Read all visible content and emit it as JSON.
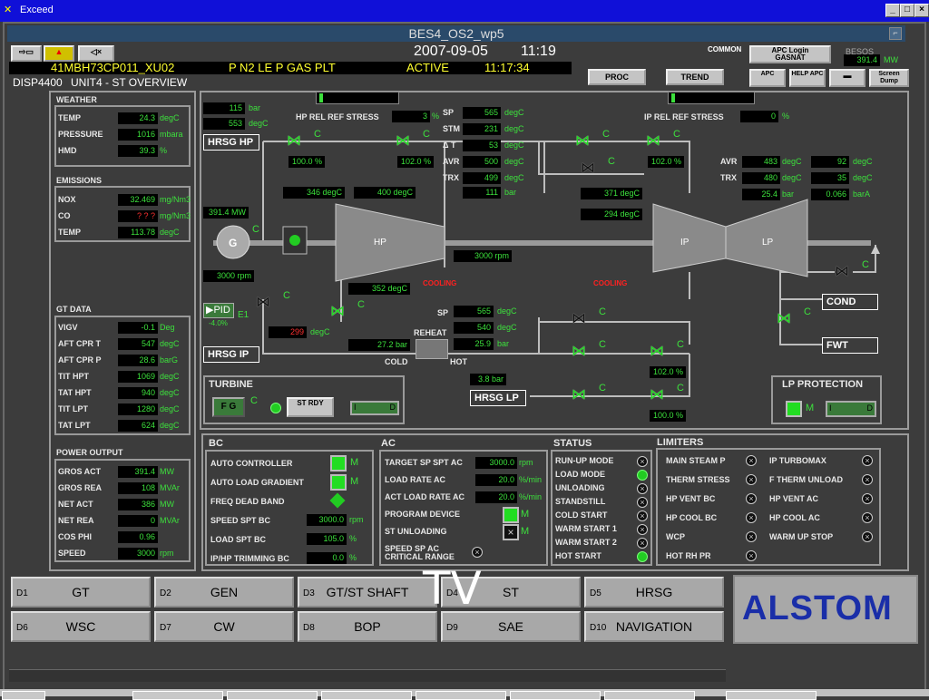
{
  "window": {
    "title": "Exceed",
    "controls": [
      "_",
      "□",
      "×"
    ]
  },
  "header": {
    "station": "BES4_OS2_wp5",
    "date": "2007-09-05",
    "time": "11:19",
    "tag": "41MBH73CP011_XU02",
    "desc": "P N2 LE P GAS PLT",
    "state": "ACTIVE",
    "clock": "11:17:34",
    "display": "DISP4400",
    "unit": "UNIT4 - ST OVERVIEW",
    "common": "COMMON",
    "apc_login": "APC Login",
    "apc_user": "GASNAT",
    "besos": "BESOS",
    "besos_val": "391.4",
    "besos_unit": "MW",
    "proc": "PROC",
    "trend": "TREND",
    "apc": "APC",
    "help_apc": "HELP APC",
    "screen_dump": "Screen Dump"
  },
  "weather": {
    "title": "WEATHER",
    "rows": [
      {
        "l": "TEMP",
        "v": "24.3",
        "u": "degC"
      },
      {
        "l": "PRESSURE",
        "v": "1016",
        "u": "mbara"
      },
      {
        "l": "HMD",
        "v": "39.3",
        "u": "%"
      }
    ]
  },
  "emissions": {
    "title": "EMISSIONS",
    "rows": [
      {
        "l": "NOX",
        "v": "32.469",
        "u": "mg/Nm3"
      },
      {
        "l": "CO",
        "v": "? ? ?",
        "u": "mg/Nm3"
      },
      {
        "l": "TEMP",
        "v": "113.78",
        "u": "degC"
      }
    ]
  },
  "gtdata": {
    "title": "GT DATA",
    "rows": [
      {
        "l": "VIGV",
        "v": "-0.1",
        "u": "Deg"
      },
      {
        "l": "AFT CPR T",
        "v": "547",
        "u": "degC"
      },
      {
        "l": "AFT CPR P",
        "v": "28.6",
        "u": "barG"
      },
      {
        "l": "TIT HPT",
        "v": "1069",
        "u": "degC"
      },
      {
        "l": "TAT HPT",
        "v": "940",
        "u": "degC"
      },
      {
        "l": "TIT LPT",
        "v": "1280",
        "u": "degC"
      },
      {
        "l": "TAT LPT",
        "v": "624",
        "u": "degC"
      }
    ]
  },
  "power": {
    "title": "POWER OUTPUT",
    "rows": [
      {
        "l": "GROS ACT",
        "v": "391.4",
        "u": "MW"
      },
      {
        "l": "GROS REA",
        "v": "108",
        "u": "MVAr"
      },
      {
        "l": "NET ACT",
        "v": "386",
        "u": "MW"
      },
      {
        "l": "NET REA",
        "v": "0",
        "u": "MVAr"
      },
      {
        "l": "COS PHI",
        "v": "0.96",
        "u": ""
      },
      {
        "l": "SPEED",
        "v": "3000",
        "u": "rpm"
      }
    ]
  },
  "diagram": {
    "hp_bar": "115",
    "hp_bar_u": "bar",
    "hp_degc": "553",
    "hp_degc_u": "degC",
    "hrsg_hp": "HRSG HP",
    "hrsg_ip": "HRSG IP",
    "hrsg_lp": "HRSG LP",
    "hp_stress": "HP REL REF STRESS",
    "hp_stress_v": "3",
    "ip_stress": "IP REL REF STRESS",
    "ip_stress_v": "0",
    "pct": "%",
    "sp": "SP",
    "stm": "STM",
    "dt": "Δ T",
    "avr": "AVR",
    "trx": "TRX",
    "sp_v": "565",
    "stm_v": "231",
    "dt_v": "53",
    "avr_v": "500",
    "trx_v": "499",
    "bar_v": "111",
    "degc": "degC",
    "bar": "bar",
    "barA": "barA",
    "v1": "100.0",
    "v2": "102.0",
    "v3": "102.0",
    "v4": "102.0",
    "v5": "100.0",
    "hp_in1": "346",
    "hp_in2": "400",
    "ip_t1": "371",
    "ip_t2": "294",
    "ip_avr": "483",
    "ip_trx": "480",
    "ip_bar": "25.4",
    "lp_t1": "92",
    "lp_t2": "35",
    "lp_p": "0.066",
    "mw": "391.4",
    "mw_u": "MW",
    "rpm1": "3000",
    "rpm2": "3000",
    "rpm_u": "rpm",
    "g": "G",
    "hp": "HP",
    "ip": "IP",
    "lp": "LP",
    "cooling": "COOLING",
    "hp_out": "352",
    "red_t": "299",
    "pid": "PID",
    "e1": "E1",
    "pid_v": "-4.0%",
    "c": "C",
    "rh_sp": "565",
    "rh_t": "540",
    "rh_p": "25.9",
    "cold_p": "27.2",
    "reheat": "REHEAT",
    "cold": "COLD",
    "hot": "HOT",
    "lp_in": "3.8",
    "cond": "COND",
    "fwt": "FWT"
  },
  "turbine": {
    "title": "TURBINE",
    "fg": "F G",
    "c": "C",
    "st_rdy": "ST RDY",
    "i": "I",
    "d": "D"
  },
  "lpprot": {
    "title": "LP PROTECTION",
    "m": "M",
    "i": "I",
    "d": "D"
  },
  "bc": {
    "title": "BC",
    "rows": [
      {
        "l": "AUTO CONTROLLER",
        "s": "M"
      },
      {
        "l": "AUTO LOAD GRADIENT",
        "s": "M"
      },
      {
        "l": "FREQ DEAD BAND",
        "s": ""
      },
      {
        "l": "SPEED SPT BC",
        "v": "3000.0",
        "u": "rpm"
      },
      {
        "l": "LOAD SPT BC",
        "v": "105.0",
        "u": "%"
      },
      {
        "l": "IP/HP TRIMMING BC",
        "v": "0.0",
        "u": "%"
      }
    ]
  },
  "ac": {
    "title": "AC",
    "rows": [
      {
        "l": "TARGET SP SPT AC",
        "v": "3000.0",
        "u": "rpm"
      },
      {
        "l": "LOAD RATE AC",
        "v": "20.0",
        "u": "%/min"
      },
      {
        "l": "ACT LOAD RATE AC",
        "v": "20.0",
        "u": "%/min"
      },
      {
        "l": "PROGRAM DEVICE",
        "s": "M"
      },
      {
        "l": "ST UNLOADING",
        "s": "M"
      },
      {
        "l": "SPEED SP AC CRITICAL RANGE",
        "s": ""
      }
    ]
  },
  "status": {
    "title": "STATUS",
    "rows": [
      "RUN-UP MODE",
      "LOAD MODE",
      "UNLOADING",
      "STANDSTILL",
      "COLD START",
      "WARM START 1",
      "WARM START 2",
      "HOT START"
    ]
  },
  "limiters": {
    "title": "LIMITERS",
    "left": [
      "MAIN STEAM P",
      "THERM STRESS",
      "HP VENT BC",
      "HP COOL BC",
      "WCP",
      "HOT RH PR"
    ],
    "right": [
      "IP TURBOMAX",
      "F THERM UNLOAD",
      "HP VENT AC",
      "HP COOL AC",
      "WARM UP STOP"
    ]
  },
  "nav": [
    {
      "k": "D1",
      "l": "GT"
    },
    {
      "k": "D2",
      "l": "GEN"
    },
    {
      "k": "D3",
      "l": "GT/ST SHAFT"
    },
    {
      "k": "D4",
      "l": "ST"
    },
    {
      "k": "D5",
      "l": "HRSG"
    },
    {
      "k": "D6",
      "l": "WSC"
    },
    {
      "k": "D7",
      "l": "CW"
    },
    {
      "k": "D8",
      "l": "BOP"
    },
    {
      "k": "D9",
      "l": "SAE"
    },
    {
      "k": "D10",
      "l": "NAVIGATION"
    }
  ],
  "logo": "ALSTOM",
  "overlay": "TV",
  "colors": {
    "green": "#3ce03c",
    "bg": "#3c3c3c",
    "title_blue": "#1010d8",
    "logo_blue": "#1a2ea8",
    "logo_red": "#e02020"
  }
}
